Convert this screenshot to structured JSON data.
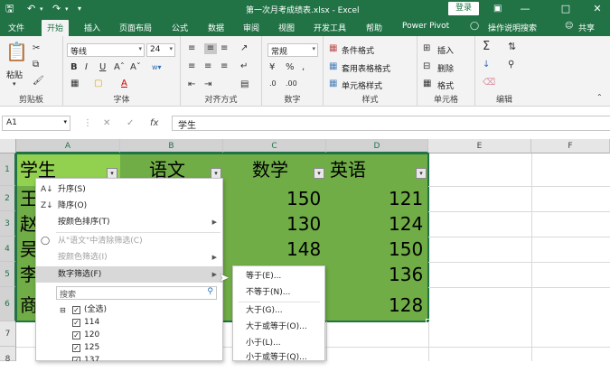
{
  "titlebar": {
    "title": "第一次月考成绩表.xlsx - Excel",
    "login": "登录"
  },
  "tabs": [
    {
      "label": "文件"
    },
    {
      "label": "开始"
    },
    {
      "label": "插入"
    },
    {
      "label": "页面布局"
    },
    {
      "label": "公式"
    },
    {
      "label": "数据"
    },
    {
      "label": "审阅"
    },
    {
      "label": "视图"
    },
    {
      "label": "开发工具"
    },
    {
      "label": "帮助"
    },
    {
      "label": "Power Pivot"
    },
    {
      "label": "操作说明搜索"
    },
    {
      "label": "共享"
    }
  ],
  "ribbon": {
    "clipboard": {
      "label": "剪贴板",
      "paste": "粘贴"
    },
    "font": {
      "label": "字体",
      "name": "等线",
      "size": "24"
    },
    "align": {
      "label": "对齐方式"
    },
    "number": {
      "label": "数字",
      "format": "常规"
    },
    "styles": {
      "label": "样式",
      "cond": "条件格式",
      "table": "套用表格格式",
      "cell": "单元格样式"
    },
    "cells": {
      "label": "单元格",
      "insert": "插入",
      "delete": "删除",
      "format": "格式"
    },
    "editing": {
      "label": "编辑"
    }
  },
  "formula": {
    "namebox": "A1",
    "content": "学生"
  },
  "columns": [
    "A",
    "B",
    "C",
    "D",
    "E",
    "F"
  ],
  "rows": [
    "1",
    "2",
    "3",
    "4",
    "5",
    "6",
    "7",
    "8"
  ],
  "sheet": {
    "headers": [
      "学生",
      "语文",
      "数学",
      "英语"
    ],
    "col_a_partial": [
      "王",
      "赵",
      "吴",
      "李",
      "商"
    ],
    "math": [
      "150",
      "130",
      "148"
    ],
    "english": [
      "121",
      "124",
      "150",
      "136",
      "128"
    ]
  },
  "filter_menu": {
    "items": [
      "升序(S)",
      "降序(O)",
      "按颜色排序(T)",
      "从\"语文\"中清除筛选(C)",
      "按颜色筛选(I)",
      "数字筛选(F)"
    ],
    "search_placeholder": "搜索",
    "checks": [
      "(全选)",
      "114",
      "120",
      "125",
      "137"
    ]
  },
  "submenu": {
    "items": [
      "等于(E)...",
      "不等于(N)...",
      "大于(G)...",
      "大于或等于(O)...",
      "小于(L)...",
      "小于或等于(Q)..."
    ]
  },
  "colors": {
    "excel_green": "#217346",
    "header_fill": "#70ad47",
    "a1_fill": "#92d050"
  }
}
